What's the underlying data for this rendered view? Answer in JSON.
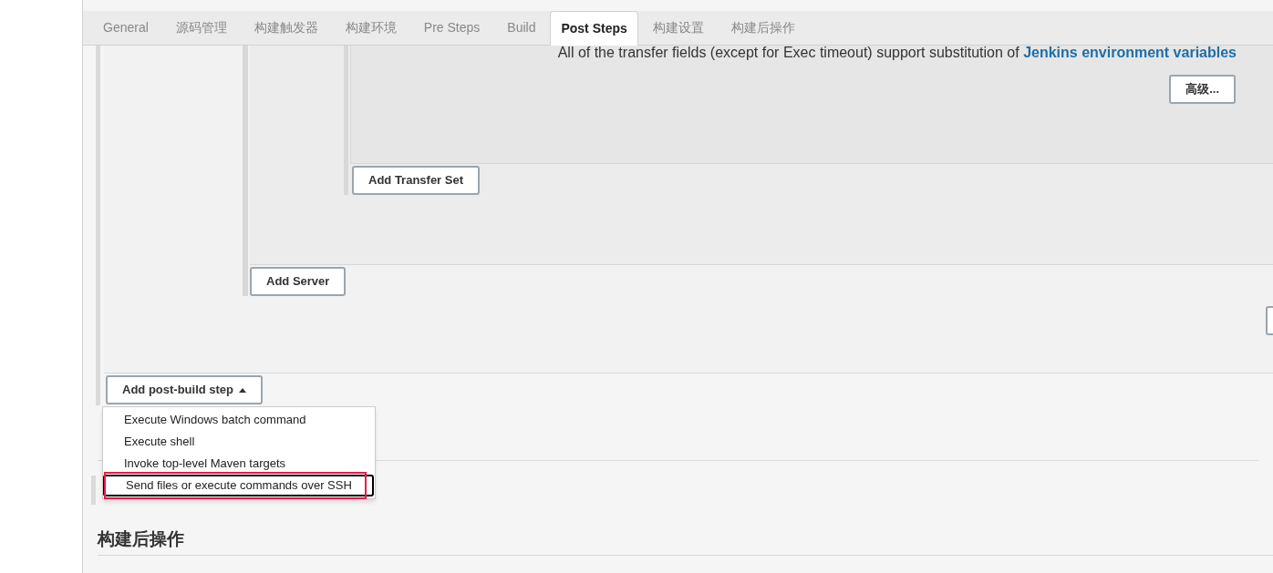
{
  "tabs": [
    {
      "label": "General",
      "selected": false
    },
    {
      "label": "源码管理",
      "selected": false
    },
    {
      "label": "构建触发器",
      "selected": false
    },
    {
      "label": "构建环境",
      "selected": false
    },
    {
      "label": "Pre Steps",
      "selected": false
    },
    {
      "label": "Build",
      "selected": false
    },
    {
      "label": "Post Steps",
      "selected": true
    },
    {
      "label": "构建设置",
      "selected": false
    },
    {
      "label": "构建后操作",
      "selected": false
    }
  ],
  "transfer_note": {
    "text": "All of the transfer fields (except for Exec timeout) support substitution of ",
    "link": "Jenkins environment variables"
  },
  "advanced_button": "高级...",
  "add_transfer_set_button": "Add Transfer Set",
  "add_server_button": "Add Server",
  "add_post_build_step_button": {
    "label": "Add post-build step",
    "expanded": true
  },
  "menu_items": [
    {
      "label": "Execute Windows batch command",
      "selected": false,
      "highlighted": false
    },
    {
      "label": "Execute shell",
      "selected": false,
      "highlighted": false
    },
    {
      "label": "Invoke top-level Maven targets",
      "selected": false,
      "highlighted": false
    },
    {
      "label": "Send files or execute commands over SSH",
      "selected": true,
      "highlighted": true
    }
  ],
  "section_heading": "构建后操作"
}
